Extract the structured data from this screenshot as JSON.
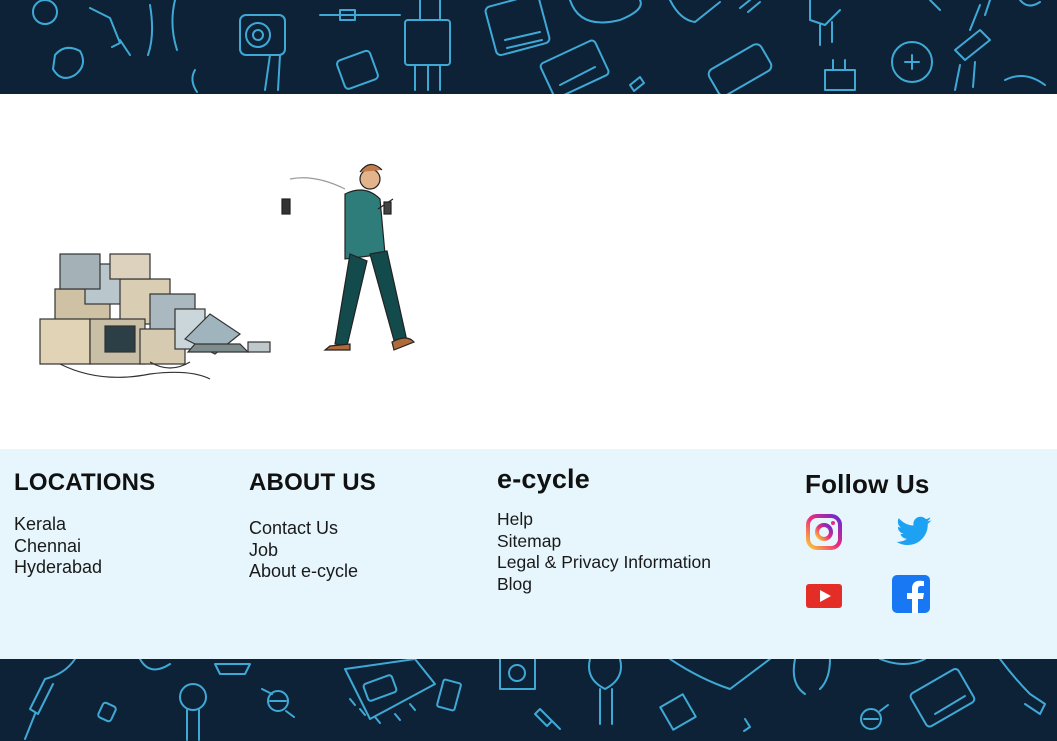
{
  "footer": {
    "locations": {
      "heading": "LOCATIONS",
      "items": [
        "Kerala",
        "Chennai",
        "Hyderabad"
      ]
    },
    "about": {
      "heading": "ABOUT US",
      "items": [
        "Contact Us",
        "Job",
        "About e-cycle"
      ]
    },
    "ecycle": {
      "heading": "e-cycle",
      "items": [
        "Help",
        "Sitemap",
        "Legal & Privacy Information",
        "Blog"
      ]
    },
    "follow": {
      "heading": "Follow Us",
      "icons": [
        "instagram-icon",
        "twitter-icon",
        "youtube-icon",
        "facebook-icon"
      ]
    }
  },
  "colors": {
    "band_background": "#0d2237",
    "band_line_art": "#3fa9d6",
    "footer_background": "#e6f6fc",
    "twitter": "#1da1f2",
    "youtube": "#e52d27",
    "facebook": "#1877f2"
  }
}
